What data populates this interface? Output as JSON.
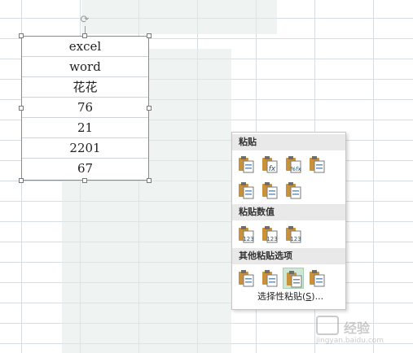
{
  "picture": {
    "cells": [
      "excel",
      "word",
      "花花",
      "76",
      "21",
      "2201",
      "67"
    ]
  },
  "paste_menu": {
    "sections": [
      {
        "title": "粘贴",
        "rows": [
          [
            {
              "icon": "paste-icon",
              "badge": ""
            },
            {
              "icon": "paste-formulas-icon",
              "badge": "fx"
            },
            {
              "icon": "paste-formulas-number-format-icon",
              "badge": "%fx"
            },
            {
              "icon": "keep-source-formatting-icon",
              "badge": ""
            }
          ],
          [
            {
              "icon": "no-borders-icon",
              "badge": ""
            },
            {
              "icon": "keep-column-widths-icon",
              "badge": ""
            },
            {
              "icon": "transpose-icon",
              "badge": ""
            }
          ]
        ]
      },
      {
        "title": "粘贴数值",
        "rows": [
          [
            {
              "icon": "paste-values-icon",
              "badge": "123"
            },
            {
              "icon": "values-number-format-icon",
              "badge": "123"
            },
            {
              "icon": "values-source-formatting-icon",
              "badge": "123"
            }
          ]
        ]
      },
      {
        "title": "其他粘贴选项",
        "rows": [
          [
            {
              "icon": "formatting-icon",
              "badge": ""
            },
            {
              "icon": "paste-link-icon",
              "badge": ""
            },
            {
              "icon": "picture-icon",
              "badge": ""
            },
            {
              "icon": "linked-picture-icon",
              "badge": ""
            }
          ]
        ]
      }
    ],
    "special_label": "选择性粘贴",
    "special_key": "S",
    "special_open": "(",
    "special_close": ")...",
    "active_option": "picture-icon"
  },
  "watermark": {
    "text": "经验",
    "url": "jingyan.baidu.com"
  }
}
